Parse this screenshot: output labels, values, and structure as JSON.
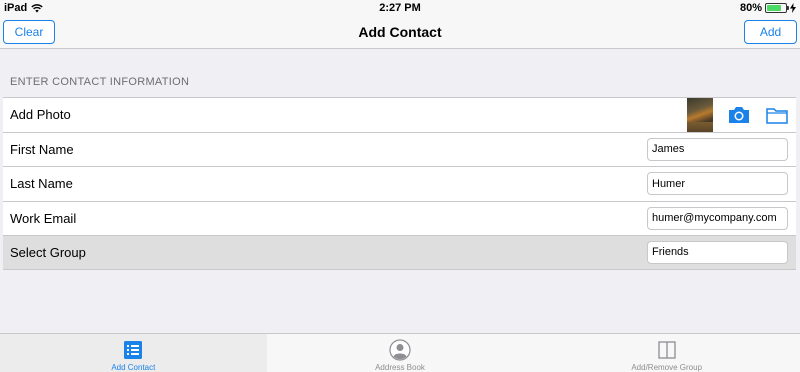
{
  "status_bar": {
    "carrier": "iPad",
    "time": "2:27 PM",
    "battery": "80%",
    "battery_level": 0.8
  },
  "nav": {
    "title": "Add Contact",
    "left_button": "Clear",
    "right_button": "Add"
  },
  "section": {
    "header": "ENTER CONTACT INFORMATION"
  },
  "rows": [
    {
      "label": "Add Photo"
    },
    {
      "label": "First Name",
      "value": "James"
    },
    {
      "label": "Last Name",
      "value": "Humer"
    },
    {
      "label": "Work Email",
      "value": "humer@mycompany.com"
    },
    {
      "label": "Select Group",
      "value": "Friends"
    }
  ],
  "icons": {
    "camera": "camera-icon",
    "folder": "folder-icon",
    "wifi": "wifi-icon",
    "battery": "battery-icon"
  },
  "tabs": [
    {
      "label": "Add Contact",
      "icon": "list-icon",
      "active": true
    },
    {
      "label": "Address Book",
      "icon": "person-icon",
      "active": false
    },
    {
      "label": "Add/Remove Group",
      "icon": "book-icon",
      "active": false
    }
  ],
  "colors": {
    "accent": "#1a82e8",
    "battery_fill": "#4cd964",
    "inactive_tab": "#8e8e93"
  }
}
